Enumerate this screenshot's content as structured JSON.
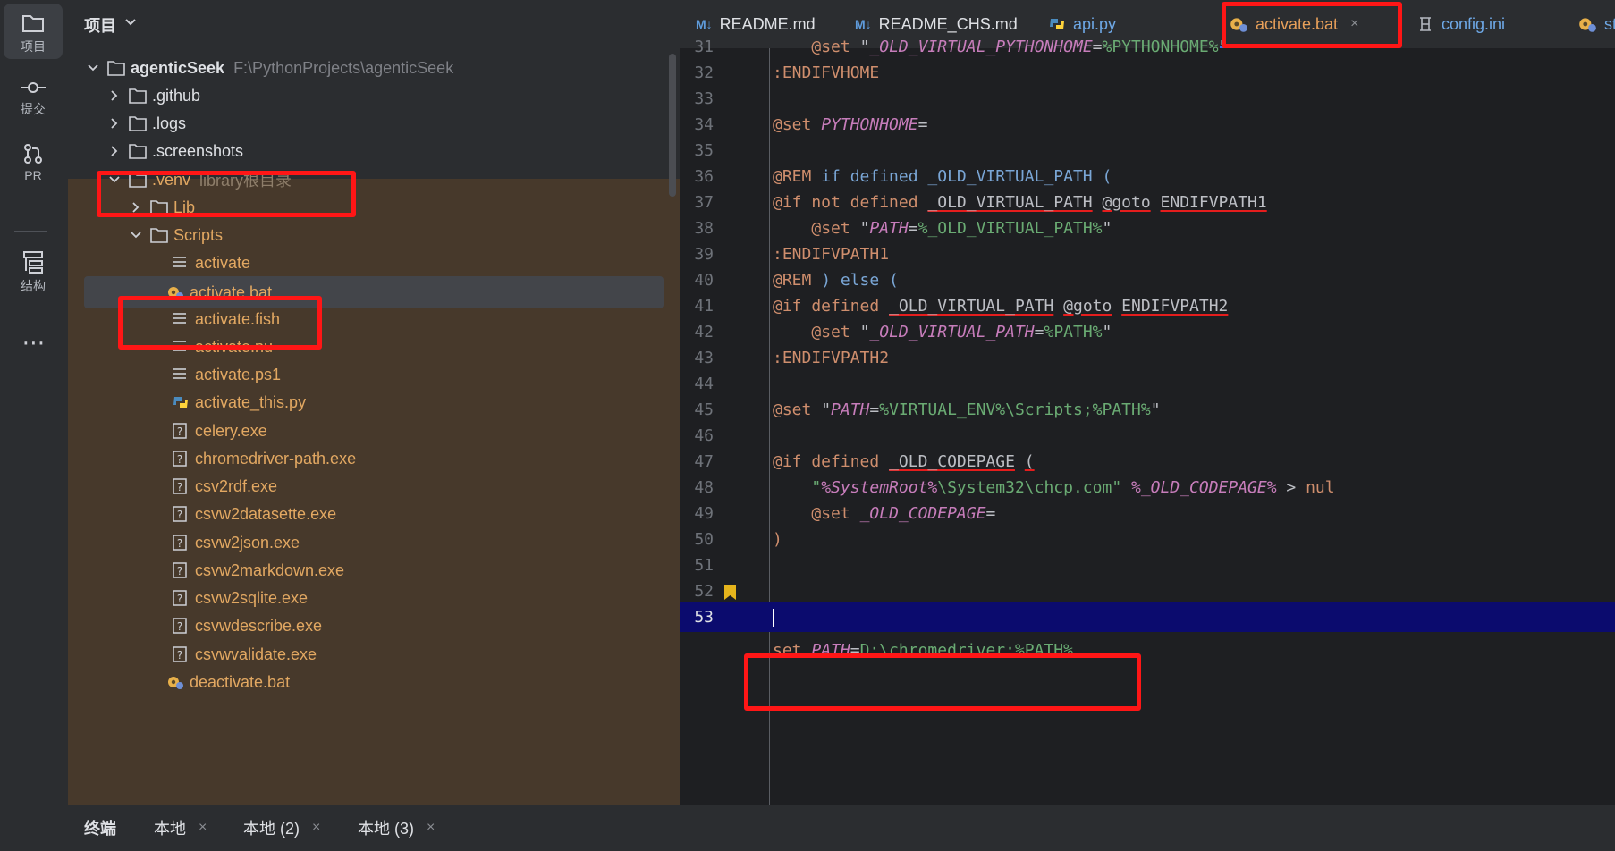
{
  "activity_bar": {
    "items": [
      {
        "label": "项目",
        "icon": "folder-icon"
      },
      {
        "label": "提交",
        "icon": "commit-icon"
      },
      {
        "label": "PR",
        "icon": "pull-request-icon"
      },
      {
        "label": "结构",
        "icon": "structure-icon"
      }
    ],
    "more": "⋯"
  },
  "project": {
    "title": "项目",
    "tree": [
      {
        "name": "agenticSeek",
        "hint": "F:\\PythonProjects\\agenticSeek",
        "type": "folder"
      },
      {
        "name": ".github",
        "type": "folder"
      },
      {
        "name": ".logs",
        "type": "folder"
      },
      {
        "name": ".screenshots",
        "type": "folder"
      },
      {
        "name": ".venv",
        "hint": "library根目录",
        "type": "folder"
      },
      {
        "name": "Lib",
        "type": "folder"
      },
      {
        "name": "Scripts",
        "type": "folder"
      },
      {
        "name": "activate",
        "type": "text"
      },
      {
        "name": "activate.bat",
        "type": "bat"
      },
      {
        "name": "activate.fish",
        "type": "text"
      },
      {
        "name": "activate.nu",
        "type": "text"
      },
      {
        "name": "activate.ps1",
        "type": "text"
      },
      {
        "name": "activate_this.py",
        "type": "python"
      },
      {
        "name": "celery.exe",
        "type": "unknown"
      },
      {
        "name": "chromedriver-path.exe",
        "type": "unknown"
      },
      {
        "name": "csv2rdf.exe",
        "type": "unknown"
      },
      {
        "name": "csvw2datasette.exe",
        "type": "unknown"
      },
      {
        "name": "csvw2json.exe",
        "type": "unknown"
      },
      {
        "name": "csvw2markdown.exe",
        "type": "unknown"
      },
      {
        "name": "csvw2sqlite.exe",
        "type": "unknown"
      },
      {
        "name": "csvwdescribe.exe",
        "type": "unknown"
      },
      {
        "name": "csvwvalidate.exe",
        "type": "unknown"
      },
      {
        "name": "deactivate.bat",
        "type": "bat"
      }
    ]
  },
  "tabs": [
    {
      "label": "README.md",
      "icon": "M↓"
    },
    {
      "label": "README_CHS.md",
      "icon": "M↓"
    },
    {
      "label": "api.py",
      "icon": "python"
    },
    {
      "label": "activate.bat",
      "icon": "bat",
      "close": "×"
    },
    {
      "label": "config.ini",
      "icon": "ini"
    },
    {
      "label": "st",
      "icon": "bat"
    }
  ],
  "editor": {
    "line_numbers": [
      "31",
      "32",
      "33",
      "34",
      "35",
      "36",
      "37",
      "38",
      "39",
      "40",
      "41",
      "42",
      "43",
      "44",
      "45",
      "46",
      "47",
      "48",
      "49",
      "50",
      "51",
      "52",
      "53"
    ],
    "current_line": "53"
  },
  "terminal": {
    "title": "终端",
    "tabs": [
      {
        "label": "本地",
        "close": "×"
      },
      {
        "label": "本地 (2)",
        "close": "×"
      },
      {
        "label": "本地 (3)",
        "close": "×"
      }
    ]
  }
}
